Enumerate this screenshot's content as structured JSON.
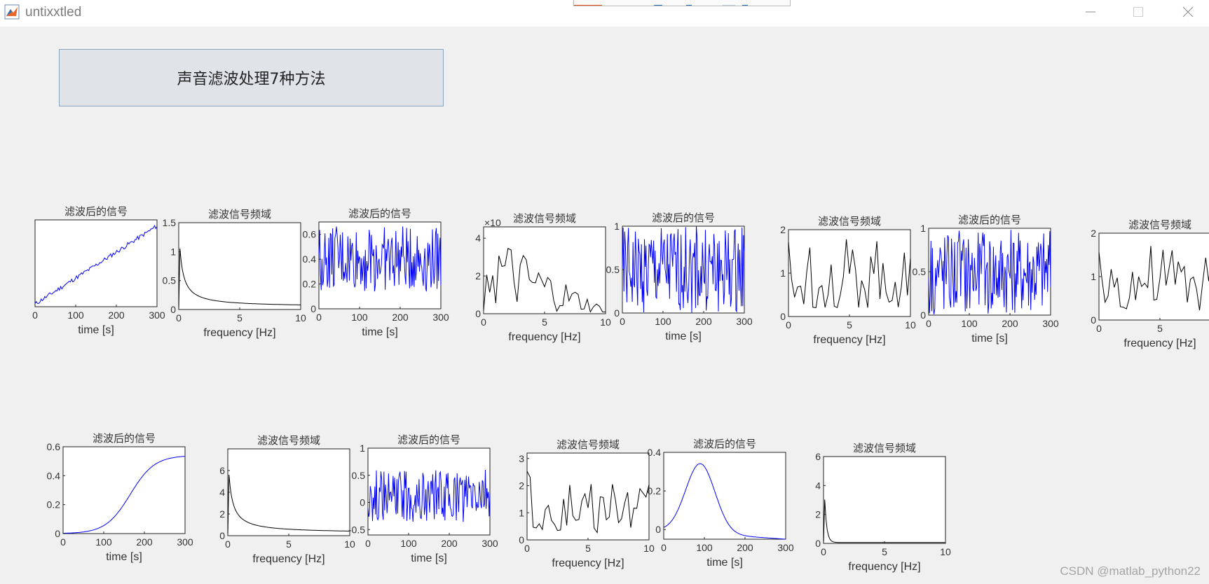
{
  "window": {
    "title": "untixxtled",
    "minimize_icon": "minimize-icon",
    "maximize_icon": "maximize-icon",
    "close_icon": "close-icon"
  },
  "main_button": {
    "label": "声音滤波处理7种方法"
  },
  "watermark": {
    "text": "CSDN @matlab_python22"
  },
  "colors": {
    "signal": "#0000ff",
    "spectrum": "#000000",
    "background": "#f0f0f0",
    "button": "#e0e4e8"
  },
  "plots": [
    {
      "id": "r1c1",
      "title": "滤波后的信号",
      "xlabel": "time [s]",
      "xticks": [
        "0",
        "100",
        "200",
        "300"
      ],
      "yticks": [],
      "xlim": [
        0,
        300
      ],
      "kind": "signal",
      "shape": "ramp",
      "color": "#0000ff"
    },
    {
      "id": "r1c2",
      "title": "滤波信号频域",
      "xlabel": "frequency [Hz]",
      "xticks": [
        "0",
        "5",
        "10"
      ],
      "yticks": [
        "0",
        "0.5",
        "1",
        "1.5"
      ],
      "xlim": [
        0,
        10
      ],
      "ylim": [
        0,
        1.5
      ],
      "kind": "spectrum",
      "shape": "decay",
      "color": "#000000"
    },
    {
      "id": "r1c3",
      "title": "滤波后的信号",
      "xlabel": "time [s]",
      "xticks": [
        "0",
        "100",
        "200",
        "300"
      ],
      "yticks": [
        "0",
        "0.2",
        "0.4",
        "0.6"
      ],
      "xlim": [
        0,
        300
      ],
      "ylim": [
        0,
        0.7
      ],
      "kind": "signal",
      "shape": "noise-mid",
      "color": "#0000ff"
    },
    {
      "id": "r1c4",
      "title": "滤波信号频域",
      "xlabel": "frequency [Hz]",
      "xticks": [
        "0",
        "5",
        "10"
      ],
      "yticks": [
        "0",
        "2",
        "4"
      ],
      "multiplier": "×10",
      "xlim": [
        0,
        10
      ],
      "ylim": [
        0,
        4.6
      ],
      "kind": "spectrum",
      "shape": "spiky-decay",
      "color": "#000000"
    },
    {
      "id": "r1c5",
      "title": "滤波后的信号",
      "xlabel": "time [s]",
      "xticks": [
        "0",
        "100",
        "200",
        "300"
      ],
      "yticks": [
        "0",
        "0.5",
        "1"
      ],
      "xlim": [
        0,
        300
      ],
      "ylim": [
        0,
        1
      ],
      "kind": "signal",
      "shape": "noise-full",
      "color": "#0000ff"
    },
    {
      "id": "r1c6",
      "title": "滤波信号频域",
      "xlabel": "frequency [Hz]",
      "xticks": [
        "0",
        "5",
        "10"
      ],
      "yticks": [
        "0",
        "1",
        "2"
      ],
      "xlim": [
        0,
        10
      ],
      "ylim": [
        0,
        2
      ],
      "kind": "spectrum",
      "shape": "spiky",
      "color": "#000000"
    },
    {
      "id": "r1c7",
      "title": "滤波后的信号",
      "xlabel": "time [s]",
      "xticks": [
        "0",
        "100",
        "200",
        "300"
      ],
      "yticks": [
        "0",
        "0.5",
        "1"
      ],
      "xlim": [
        0,
        300
      ],
      "ylim": [
        0,
        1
      ],
      "kind": "signal",
      "shape": "noise-full",
      "color": "#0000ff"
    },
    {
      "id": "r1c8",
      "title": "滤波信号频域",
      "xlabel": "frequency [Hz]",
      "xticks": [
        "0",
        "5"
      ],
      "yticks": [
        "0",
        "1",
        "2"
      ],
      "xlim": [
        0,
        10
      ],
      "ylim": [
        0,
        2
      ],
      "kind": "spectrum",
      "shape": "spiky",
      "color": "#000000"
    },
    {
      "id": "r2c1",
      "title": "滤波后的信号",
      "xlabel": "time [s]",
      "xticks": [
        "0",
        "100",
        "200",
        "300"
      ],
      "yticks": [
        "0",
        "0.2",
        "0.4",
        "0.6"
      ],
      "xlim": [
        0,
        300
      ],
      "ylim": [
        0,
        0.6
      ],
      "kind": "signal",
      "shape": "sigmoid",
      "color": "#0000ff"
    },
    {
      "id": "r2c2",
      "title": "滤波信号频域",
      "xlabel": "frequency [Hz]",
      "xticks": [
        "0",
        "5",
        "10"
      ],
      "yticks": [
        "0",
        "2",
        "4",
        "6"
      ],
      "xlim": [
        0,
        10
      ],
      "ylim": [
        0,
        8
      ],
      "kind": "spectrum",
      "shape": "decay",
      "color": "#000000"
    },
    {
      "id": "r2c3",
      "title": "滤波后的信号",
      "xlabel": "time [s]",
      "xticks": [
        "0",
        "100",
        "200",
        "300"
      ],
      "yticks": [
        "-0.5",
        "0",
        "0.5",
        "1"
      ],
      "xlim": [
        0,
        300
      ],
      "ylim": [
        -0.6,
        1
      ],
      "kind": "signal",
      "shape": "noise-zero",
      "color": "#0000ff"
    },
    {
      "id": "r2c4",
      "title": "滤波信号频域",
      "xlabel": "frequency [Hz]",
      "xticks": [
        "0",
        "5",
        "10"
      ],
      "yticks": [
        "0",
        "1",
        "2",
        "3"
      ],
      "xlim": [
        0,
        10
      ],
      "ylim": [
        0,
        3.2
      ],
      "kind": "spectrum",
      "shape": "spiky3",
      "color": "#000000"
    },
    {
      "id": "r2c5",
      "title": "滤波后的信号",
      "xlabel": "time [s]",
      "xticks": [
        "0",
        "100",
        "200",
        "300"
      ],
      "yticks": [
        "0",
        "0.2",
        "0.4"
      ],
      "xlim": [
        0,
        300
      ],
      "ylim": [
        -0.05,
        0.4
      ],
      "kind": "signal",
      "shape": "bump",
      "color": "#0000ff"
    },
    {
      "id": "r2c6",
      "title": "滤波信号频域",
      "xlabel": "frequency [Hz]",
      "xticks": [
        "0",
        "5",
        "10"
      ],
      "yticks": [
        "0",
        "2",
        "4",
        "6"
      ],
      "xlim": [
        0,
        10
      ],
      "ylim": [
        0,
        6
      ],
      "kind": "spectrum",
      "shape": "sharp-decay",
      "color": "#000000"
    }
  ]
}
